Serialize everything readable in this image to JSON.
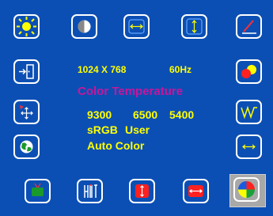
{
  "resolution": {
    "text": "1024  X  768",
    "freq": "60Hz"
  },
  "panel": {
    "title": "Color Temperature",
    "options_row1": [
      "9300",
      "6500",
      "5400"
    ],
    "options_row2": [
      "sRGB",
      "User"
    ],
    "auto_color": "Auto Color"
  },
  "selected_tab": "color-tab",
  "colors": {
    "background": "#0c4fb4",
    "accent_yellow": "#ffff00",
    "title_magenta": "#c8169a",
    "selection_gray": "#a8a8a8"
  },
  "icons": {
    "top": [
      "brightness-icon",
      "contrast-icon",
      "h-position-icon",
      "v-position-icon",
      "pen-icon"
    ],
    "left": [
      "exit-icon",
      "move-icon",
      "language-icon"
    ],
    "right": [
      "color-balls-icon",
      "waveform-icon",
      "h-size-icon"
    ],
    "bottom": [
      "tv-icon",
      "tools-icon",
      "v-size-icon",
      "h-resize-icon",
      "color-icon"
    ]
  }
}
